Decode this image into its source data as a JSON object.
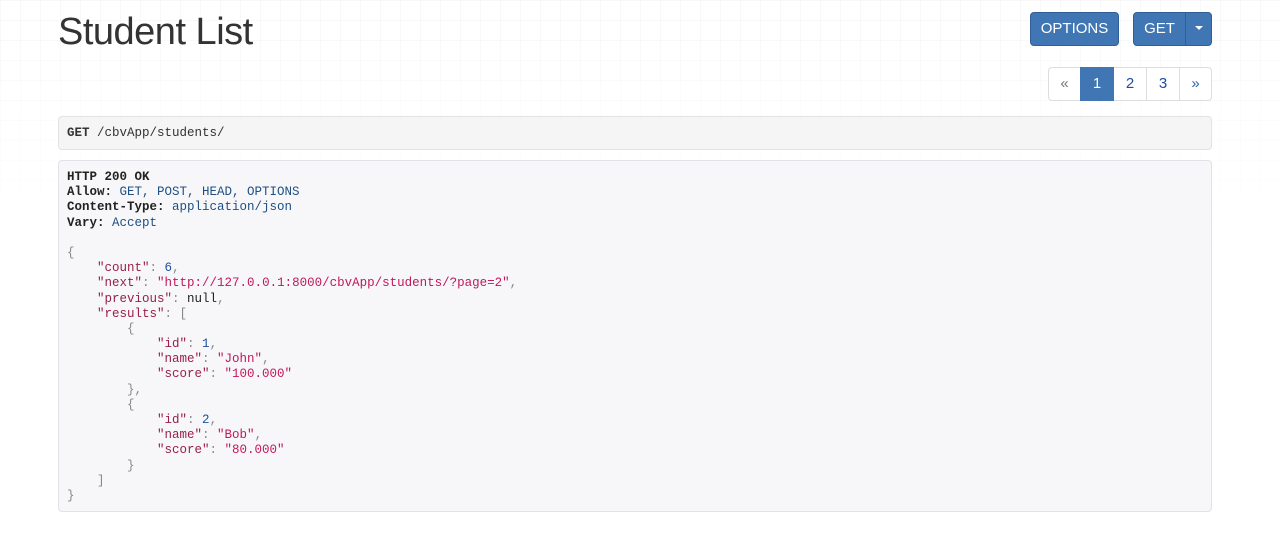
{
  "page": {
    "title": "Student List"
  },
  "actions": {
    "options_label": "OPTIONS",
    "get_label": "GET"
  },
  "pagination": {
    "prev": "«",
    "next": "»",
    "pages": [
      "1",
      "2",
      "3"
    ],
    "current": "1"
  },
  "request": {
    "method": "GET",
    "path": " /cbvApp/students/"
  },
  "response": {
    "status": "HTTP 200 OK",
    "headers": [
      {
        "key": "Allow:",
        "value": " GET, POST, HEAD, OPTIONS"
      },
      {
        "key": "Content-Type:",
        "value": " application/json"
      },
      {
        "key": "Vary:",
        "value": " Accept"
      }
    ],
    "body": {
      "open_brace": "{",
      "close_brace": "}",
      "count_key": "\"count\"",
      "count_value": "6",
      "next_key": "\"next\"",
      "next_value": "\"http://127.0.0.1:8000/cbvApp/students/?page=2\"",
      "previous_key": "\"previous\"",
      "previous_value": "null",
      "results_key": "\"results\"",
      "results_open": "[",
      "results_close": "]",
      "results": [
        {
          "id": "1",
          "name": "\"John\"",
          "score": "\"100.000\""
        },
        {
          "id": "2",
          "name": "\"Bob\"",
          "score": "\"80.000\""
        }
      ],
      "id_key": "\"id\"",
      "name_key": "\"name\"",
      "score_key": "\"score\""
    }
  },
  "colors": {
    "primary": "#3f76b3",
    "link": "#2f6aa5",
    "json_string": "#c2185b",
    "json_number": "#1d4f9e"
  }
}
